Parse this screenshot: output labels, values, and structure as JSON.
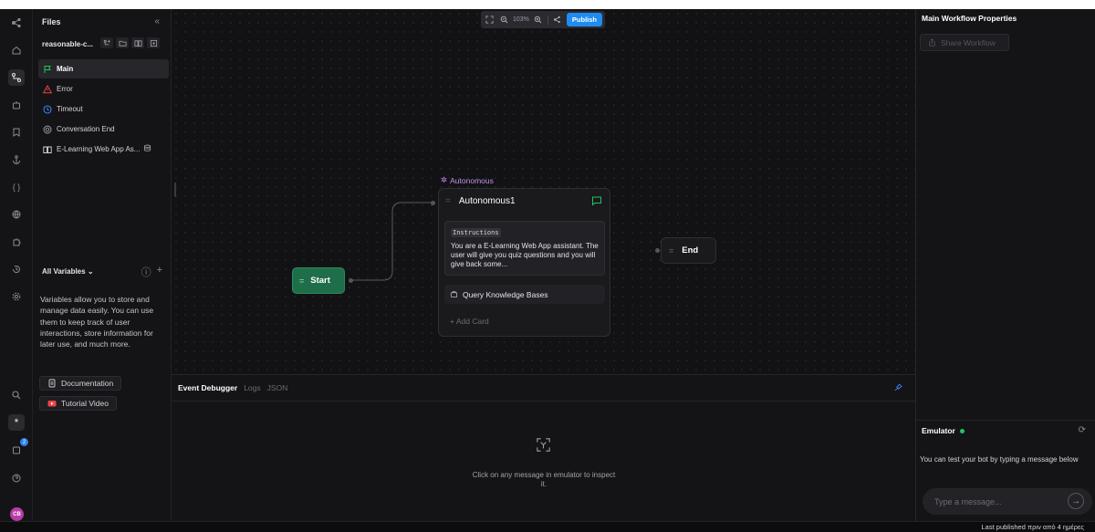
{
  "files": {
    "title": "Files",
    "project_name": "reasonable-c...",
    "items": [
      {
        "label": "Main",
        "color": "#22c55e"
      },
      {
        "label": "Error",
        "color": "#ef4444"
      },
      {
        "label": "Timeout",
        "color": "#3b82f6"
      },
      {
        "label": "Conversation End",
        "color": "#a1a1aa"
      },
      {
        "label": "E-Learning Web App As...",
        "color": "#d4d4d8"
      }
    ]
  },
  "variables": {
    "header": "All Variables",
    "description": "Variables allow you to store and manage data easily. You can use them to keep track of user interactions, store information for later use, and much more.",
    "documentation_label": "Documentation",
    "tutorial_label": "Tutorial Video"
  },
  "toolbar": {
    "zoom": "103%",
    "publish_label": "Publish"
  },
  "canvas": {
    "start_label": "Start",
    "autonomous_type": "Autonomous",
    "autonomous_title": "Autonomous1",
    "instructions_tag": "Instructions",
    "instructions_text": "You are a E-Learning Web App assistant. The user will give you quiz questions and you will give back some...",
    "knowledge_label": "Query Knowledge Bases",
    "add_card_label": "+ Add Card",
    "end_label": "End"
  },
  "debugger": {
    "tabs": [
      "Event Debugger",
      "Logs",
      "JSON"
    ],
    "empty_message": "Click on any message in emulator to inspect it."
  },
  "properties": {
    "title": "Main Workflow Properties",
    "share_label": "Share Workflow"
  },
  "emulator": {
    "title": "Emulator",
    "hint": "You can test your bot by typing a message below",
    "placeholder": "Type a message..."
  },
  "status": {
    "last_published": "Last published πριν από 4 ημέρες"
  },
  "user": {
    "initials": "CB",
    "notification_count": "2"
  },
  "colors": {
    "accent": "#1e8cf0",
    "start_node": "#1f6e4a",
    "autonomous": "#c490f5"
  }
}
